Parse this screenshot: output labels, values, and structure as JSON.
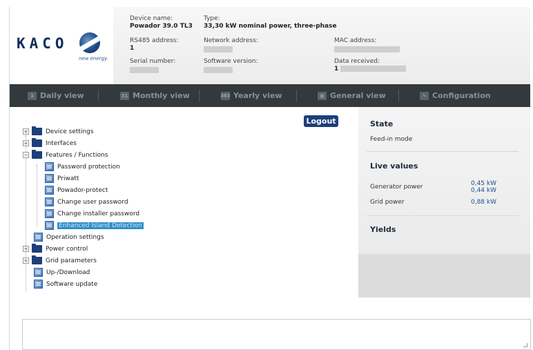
{
  "header": {
    "brand": "KACO",
    "brand_sub": "new energy.",
    "device_name_label": "Device name:",
    "device_name_value": "Powador 39.0 TL3",
    "type_label": "Type:",
    "type_value": "33,30 kW nominal power, three-phase",
    "rs485_label": "RS485 address:",
    "rs485_value": "1",
    "network_label": "Network address:",
    "mac_label": "MAC address:",
    "serial_label": "Serial number:",
    "software_label": "Software version:",
    "data_received_label": "Data received:",
    "data_received_value": "1"
  },
  "nav": {
    "items": [
      {
        "label": "Daily view",
        "icon": "calendar-day-icon"
      },
      {
        "label": "Monthly view",
        "icon": "calendar-month-icon"
      },
      {
        "label": "Yearly view",
        "icon": "calendar-year-icon"
      },
      {
        "label": "General view",
        "icon": "overview-icon"
      },
      {
        "label": "Configuration",
        "icon": "wrench-icon"
      }
    ]
  },
  "logout_label": "Logout",
  "tree": {
    "device_settings": "Device settings",
    "interfaces": "Interfaces",
    "features": "Features / Functions",
    "password_protection": "Password protection",
    "priwatt": "Priwatt",
    "powador_protect": "Powador-protect",
    "change_user_password": "Change user password",
    "change_installer_password": "Change installer password",
    "enhanced_island_detection": "Enhanced Island Detection",
    "operation_settings": "Operation settings",
    "power_control": "Power control",
    "grid_parameters": "Grid parameters",
    "up_download": "Up-/Download",
    "software_update": "Software update"
  },
  "panel": {
    "state_title": "State",
    "state_value": "Feed-in mode",
    "live_title": "Live values",
    "generator_label": "Generator power",
    "generator_value_1": "0,45 kW",
    "generator_value_2": "0,44 kW",
    "grid_label": "Grid power",
    "grid_value": "0,88 kW",
    "yields_title": "Yields"
  },
  "colors": {
    "nav_bg": "#33393c",
    "brand_blue": "#1d3f7a",
    "selected_bg": "#2f8fc9"
  }
}
